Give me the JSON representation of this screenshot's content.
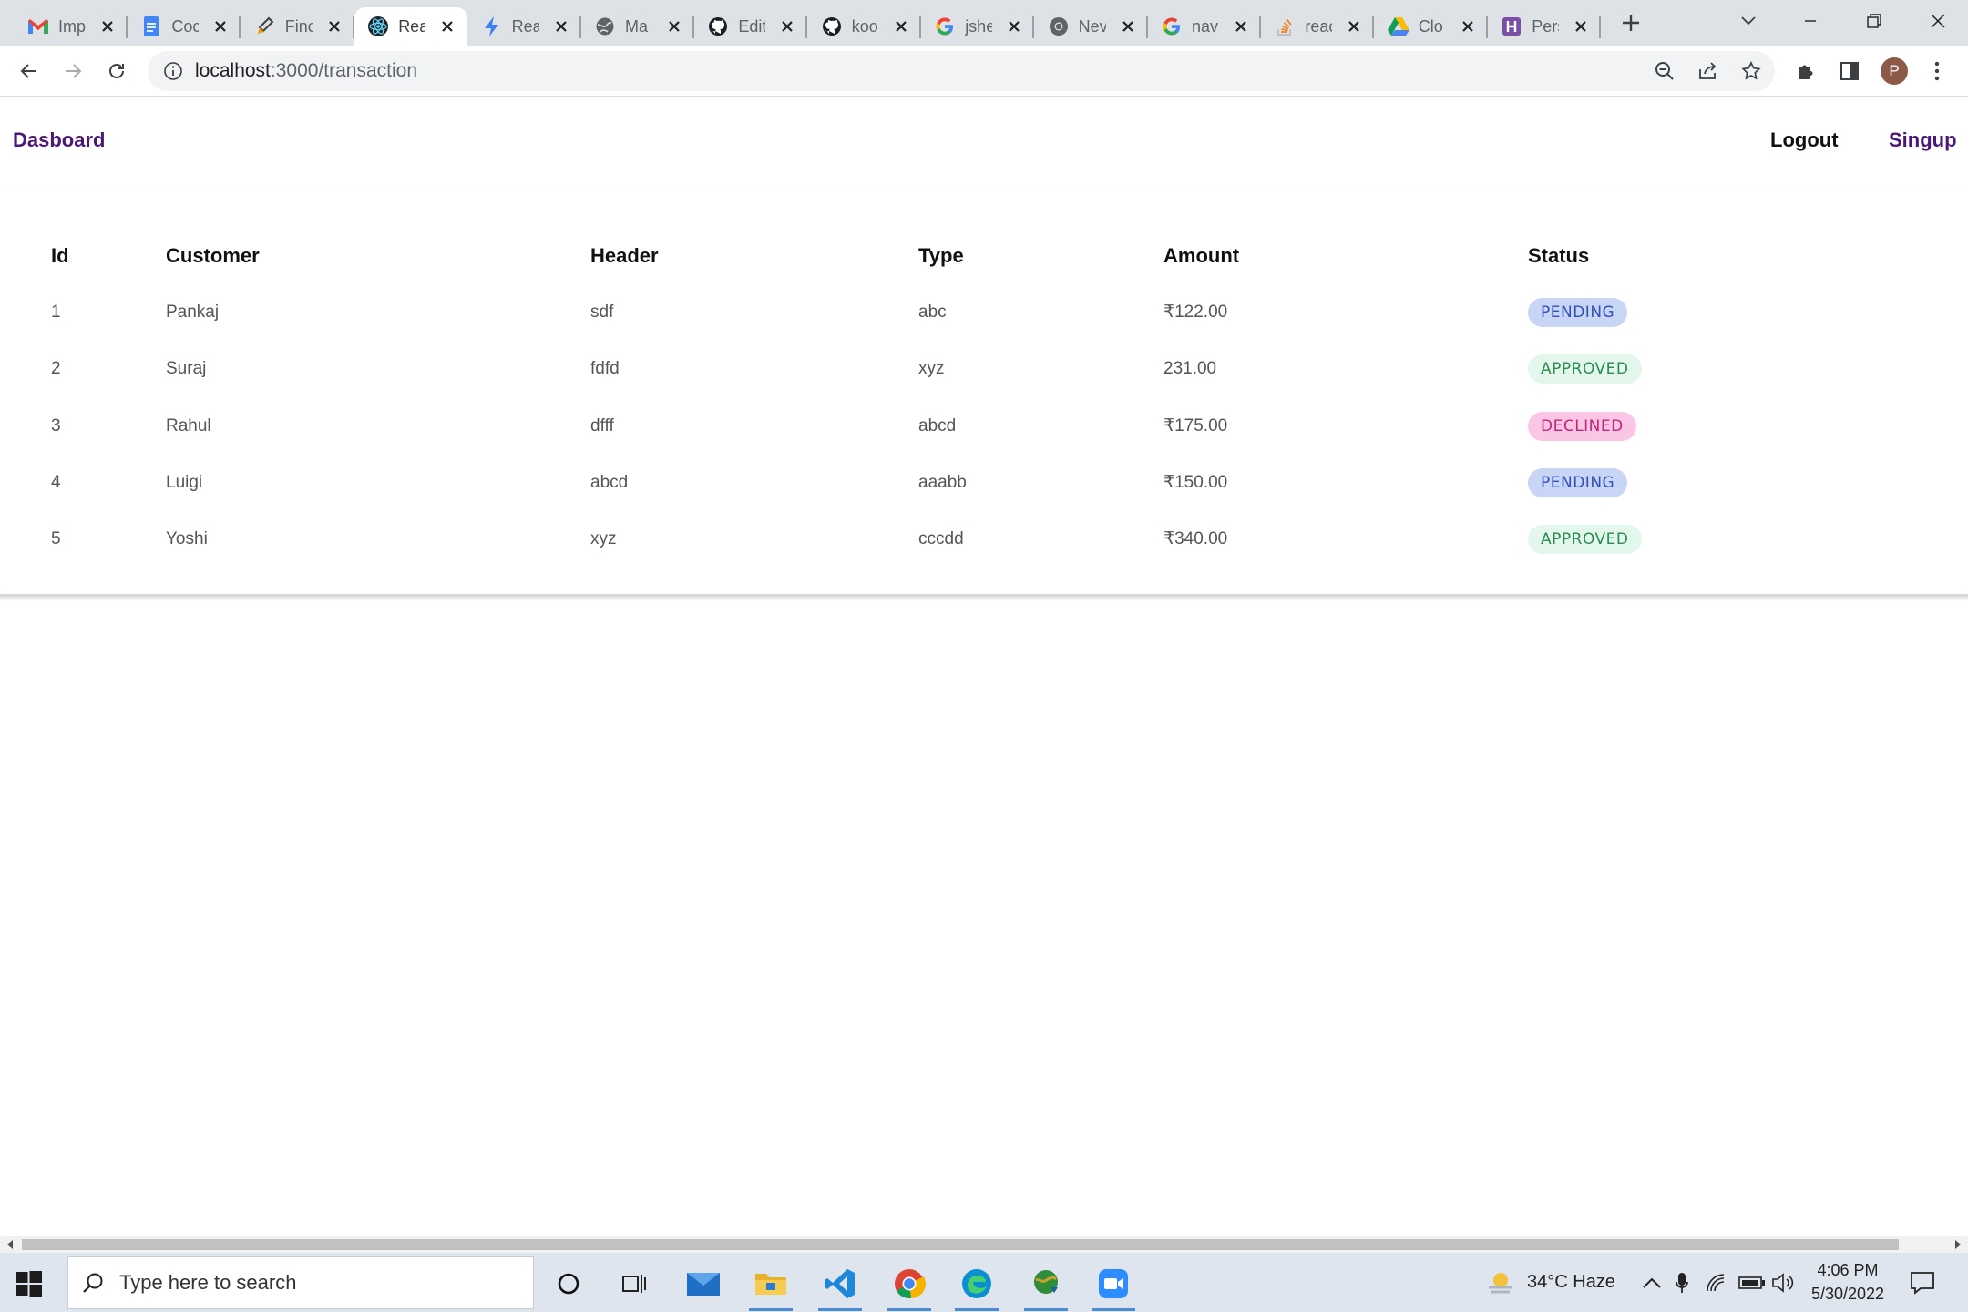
{
  "browser": {
    "tabs": [
      {
        "title": "Imp",
        "icon": "gmail-icon"
      },
      {
        "title": "Coc",
        "icon": "docs-icon"
      },
      {
        "title": "Finc",
        "icon": "blog-icon"
      },
      {
        "title": "Rea",
        "icon": "react-icon",
        "active": true
      },
      {
        "title": "Rea",
        "icon": "bolt-icon"
      },
      {
        "title": "Ma",
        "icon": "globe-icon"
      },
      {
        "title": "Edit",
        "icon": "github-icon"
      },
      {
        "title": "koo",
        "icon": "github-icon"
      },
      {
        "title": "jshe",
        "icon": "google-icon"
      },
      {
        "title": "Nev",
        "icon": "chrome-icon"
      },
      {
        "title": "nav",
        "icon": "google-icon"
      },
      {
        "title": "reac",
        "icon": "stackoverflow-icon"
      },
      {
        "title": "Clo",
        "icon": "drive-icon"
      },
      {
        "title": "Pers",
        "icon": "h-icon"
      }
    ],
    "url_host": "localhost",
    "url_path": ":3000/transaction",
    "profile_initial": "P"
  },
  "nav": {
    "brand": "Dasboard",
    "logout": "Logout",
    "signup": "Singup"
  },
  "table": {
    "headers": {
      "id": "Id",
      "customer": "Customer",
      "header": "Header",
      "type": "Type",
      "amount": "Amount",
      "status": "Status"
    },
    "rows": [
      {
        "id": "1",
        "customer": "Pankaj",
        "header": "sdf",
        "type": "abc",
        "amount": "₹122.00",
        "status": "PENDING"
      },
      {
        "id": "2",
        "customer": "Suraj",
        "header": "fdfd",
        "type": "xyz",
        "amount": "231.00",
        "status": "APPROVED"
      },
      {
        "id": "3",
        "customer": "Rahul",
        "header": "dfff",
        "type": "abcd",
        "amount": "₹175.00",
        "status": "DECLINED"
      },
      {
        "id": "4",
        "customer": "Luigi",
        "header": "abcd",
        "type": "aaabb",
        "amount": "₹150.00",
        "status": "PENDING"
      },
      {
        "id": "5",
        "customer": "Yoshi",
        "header": "xyz",
        "type": "cccdd",
        "amount": "₹340.00",
        "status": "APPROVED"
      }
    ]
  },
  "status_colors": {
    "PENDING": {
      "bg": "#c9d5f5",
      "fg": "#3251b8"
    },
    "APPROVED": {
      "bg": "#e4f7ec",
      "fg": "#2b8a4f"
    },
    "DECLINED": {
      "bg": "#fbc6e5",
      "fg": "#c3247a"
    }
  },
  "taskbar": {
    "search_placeholder": "Type here to search",
    "weather": "34°C  Haze",
    "time": "4:06 PM",
    "date": "5/30/2022"
  }
}
